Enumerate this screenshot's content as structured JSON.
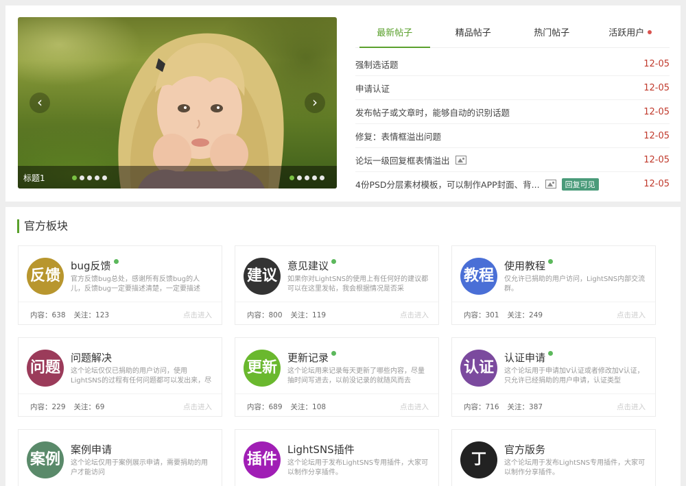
{
  "slider": {
    "caption": "标题1",
    "prev_icon": "chevron-left-icon",
    "next_icon": "chevron-right-icon",
    "dot_count": 5,
    "active_dot": 1
  },
  "tabs": [
    {
      "label": "最新帖子",
      "active": true
    },
    {
      "label": "精品帖子",
      "active": false
    },
    {
      "label": "热门帖子",
      "active": false
    },
    {
      "label": "活跃用户",
      "active": false,
      "dot": true
    }
  ],
  "posts": [
    {
      "title": "强制选话题",
      "date": "12-05"
    },
    {
      "title": "申请认证",
      "date": "12-05"
    },
    {
      "title": "发布帖子或文章时，能够自动的识别话题",
      "date": "12-05"
    },
    {
      "title": "修复：表情框溢出问题",
      "date": "12-05"
    },
    {
      "title": "论坛一级回复框表情溢出",
      "date": "12-05",
      "image": true
    },
    {
      "title": "4份PSD分层素材模板，可以制作APP封面、背...",
      "date": "12-05",
      "image": true,
      "badge": "回复可见"
    }
  ],
  "section": {
    "title": "官方板块"
  },
  "boards": [
    {
      "logo": "反馈",
      "color": "#b8962e",
      "name": "bug反馈",
      "desc": "官方反馈bug总处，感谢所有反馈bug的人儿，反馈bug一定要描述清楚，一定要描述",
      "content": "内容：638",
      "follow": "关注：123",
      "enter": "点击进入"
    },
    {
      "logo": "建议",
      "color": "#333333",
      "name": "意见建议",
      "desc": "如果你对LightSNS的使用上有任何好的建议都可以在这里发帖，我会根据情况是否采",
      "content": "内容：800",
      "follow": "关注：119",
      "enter": "点击进入"
    },
    {
      "logo": "教程",
      "color": "#4a6fd6",
      "name": "使用教程",
      "desc": "仅允许已捐助的用户访问，LightSNS内部交流群。",
      "content": "内容：301",
      "follow": "关注：249",
      "enter": "点击进入"
    },
    {
      "logo": "问题",
      "color": "#9b3b5a",
      "name": "问题解决",
      "desc": "这个论坛仅仅已捐助的用户访问，使用LightSNS的过程有任何问题都可以发出来，尽",
      "content": "内容：229",
      "follow": "关注：69",
      "enter": "点击进入"
    },
    {
      "logo": "更新",
      "color": "#6ab82e",
      "name": "更新记录",
      "desc": "这个论坛用来记录每天更新了哪些内容，尽量抽时间写进去，以前没记录的就随风而去",
      "content": "内容：689",
      "follow": "关注：108",
      "enter": "点击进入"
    },
    {
      "logo": "认证",
      "color": "#7b4a9e",
      "name": "认证申请",
      "desc": "这个论坛用于申请加V认证或者修改加V认证，只允许已经捐助的用户申请，认证类型",
      "content": "内容：716",
      "follow": "关注：387",
      "enter": "点击进入"
    },
    {
      "logo": "案例",
      "color": "#5a8a6a",
      "name": "案例申请",
      "desc": "这个论坛仅用于案例展示申请，需要捐助的用户才能访问",
      "content": "",
      "follow": "",
      "enter": ""
    },
    {
      "logo": "插件",
      "color": "#a01eb5",
      "name": "LightSNS插件",
      "desc": "这个论坛用于发布LightSNS专用插件，大家可以制作分享插件。",
      "content": "",
      "follow": "",
      "enter": ""
    },
    {
      "logo": "丁",
      "color": "#222222",
      "name": "官方版务",
      "desc": "这个论坛用于发布LightSNS专用插件，大家可以制作分享插件。",
      "content": "",
      "follow": "",
      "enter": ""
    }
  ]
}
